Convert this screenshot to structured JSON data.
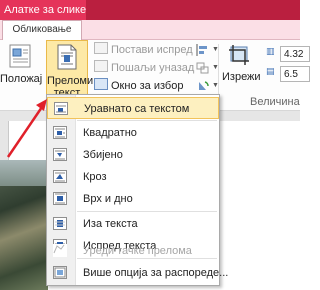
{
  "ribbon_header": {
    "context_tab_label": "Алатке за слике",
    "active_tab_label": "Обликовање",
    "context_color": "#e5335a",
    "titlebar_color": "#ba1f3f"
  },
  "ribbon": {
    "position_label": "Положај",
    "wrap_text_label_line1": "Преломи",
    "wrap_text_label_line2": "текст",
    "bring_forward_label": "Постави испред",
    "send_backward_label": "Пошаљи уназад",
    "selection_pane_label": "Окно за избор",
    "crop_label": "Изрежи",
    "height_value": "4.32",
    "width_value": "6.5",
    "size_group_label": "Величина"
  },
  "wrap_menu": {
    "items": [
      {
        "label": "Уравнато са текстом",
        "icon": "wrap-inline-icon",
        "enabled": true,
        "highlighted": true
      },
      {
        "label": "Квадратно",
        "icon": "wrap-square-icon",
        "enabled": true
      },
      {
        "label": "Збијено",
        "icon": "wrap-tight-icon",
        "enabled": true
      },
      {
        "label": "Кроз",
        "icon": "wrap-through-icon",
        "enabled": true
      },
      {
        "label": "Врх и дно",
        "icon": "wrap-top-bottom-icon",
        "enabled": true
      },
      {
        "label": "Иза текста",
        "icon": "wrap-behind-text-icon",
        "enabled": true
      },
      {
        "label": "Испред текста",
        "icon": "wrap-in-front-icon",
        "enabled": true
      },
      {
        "label": "Уреди тачке прелома",
        "icon": "edit-wrap-points-icon",
        "enabled": false
      },
      {
        "label": "Више опција за распореде...",
        "icon": "more-layout-options-icon",
        "enabled": true
      }
    ]
  },
  "annotation": {
    "arrow_color": "#e0202a"
  }
}
